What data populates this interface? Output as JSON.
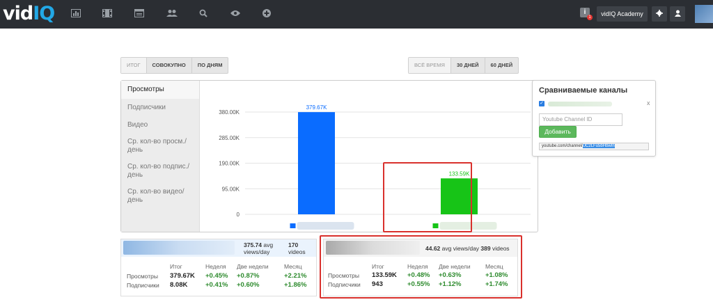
{
  "brand": {
    "logo_a": "vid",
    "logo_b": "IQ"
  },
  "header": {
    "nav_icons": [
      "dashboard-icon",
      "film-icon",
      "window-icon",
      "users-icon",
      "search-icon",
      "eye-icon",
      "plus-circle-icon"
    ],
    "info_label": "i",
    "info_badge": "1",
    "academy_label": "vidIQ Academy"
  },
  "view_tabs": [
    "ИТОГ",
    "СОВОКУПНО",
    "ПО ДНЯМ"
  ],
  "range_tabs": [
    "ВСЁ ВРЕМЯ",
    "30 ДНЕЙ",
    "60 ДНЕЙ"
  ],
  "metrics": [
    "Просмотры",
    "Подписчики",
    "Видео",
    "Ср. кол-во просм./ день",
    "Ср. кол-во подпис./ день",
    "Ср. кол-во видео/ день"
  ],
  "chart_data": {
    "type": "bar",
    "categories": [
      "",
      ""
    ],
    "values": [
      379670,
      133590
    ],
    "value_labels": [
      "379.67K",
      "133.59K"
    ],
    "colors": [
      "#0a6cff",
      "#17c417"
    ],
    "ylim": [
      0,
      380000
    ],
    "yticks": [
      0,
      95000,
      190000,
      285000,
      380000
    ],
    "ytick_labels": [
      "0",
      "95.00K",
      "190.00K",
      "285.00K",
      "380.00K"
    ],
    "grid": true,
    "legend": "bottom"
  },
  "compare": {
    "title": "Сравниваемые каналы",
    "close": "x",
    "input_placeholder": "Youtube Channel ID",
    "add_label": "Добавить",
    "url_prefix": "youtube.com/channel/",
    "url_id": "UC2LFu5bHbwIn"
  },
  "cards": [
    {
      "head_avg": "375.74",
      "head_avg_unit": "avg views/day",
      "head_videos": "170",
      "head_videos_unit": "videos",
      "headers": [
        "Итог",
        "Неделя",
        "Две недели",
        "Месяц"
      ],
      "rows": [
        {
          "label": "Просмотры",
          "total": "379.67K",
          "week": "+0.45%",
          "two_weeks": "+0.87%",
          "month": "+2.21%"
        },
        {
          "label": "Подписчики",
          "total": "8.08K",
          "week": "+0.41%",
          "two_weeks": "+0.60%",
          "month": "+1.86%"
        }
      ]
    },
    {
      "head_avg": "44.62",
      "head_avg_unit": "avg views/day",
      "head_videos": "389",
      "head_videos_unit": "videos",
      "headers": [
        "Итог",
        "Неделя",
        "Две недели",
        "Месяц"
      ],
      "rows": [
        {
          "label": "Просмотры",
          "total": "133.59K",
          "week": "+0.48%",
          "two_weeks": "+0.63%",
          "month": "+1.08%"
        },
        {
          "label": "Подписчики",
          "total": "943",
          "week": "+0.55%",
          "two_weeks": "+1.12%",
          "month": "+1.74%"
        }
      ]
    }
  ]
}
